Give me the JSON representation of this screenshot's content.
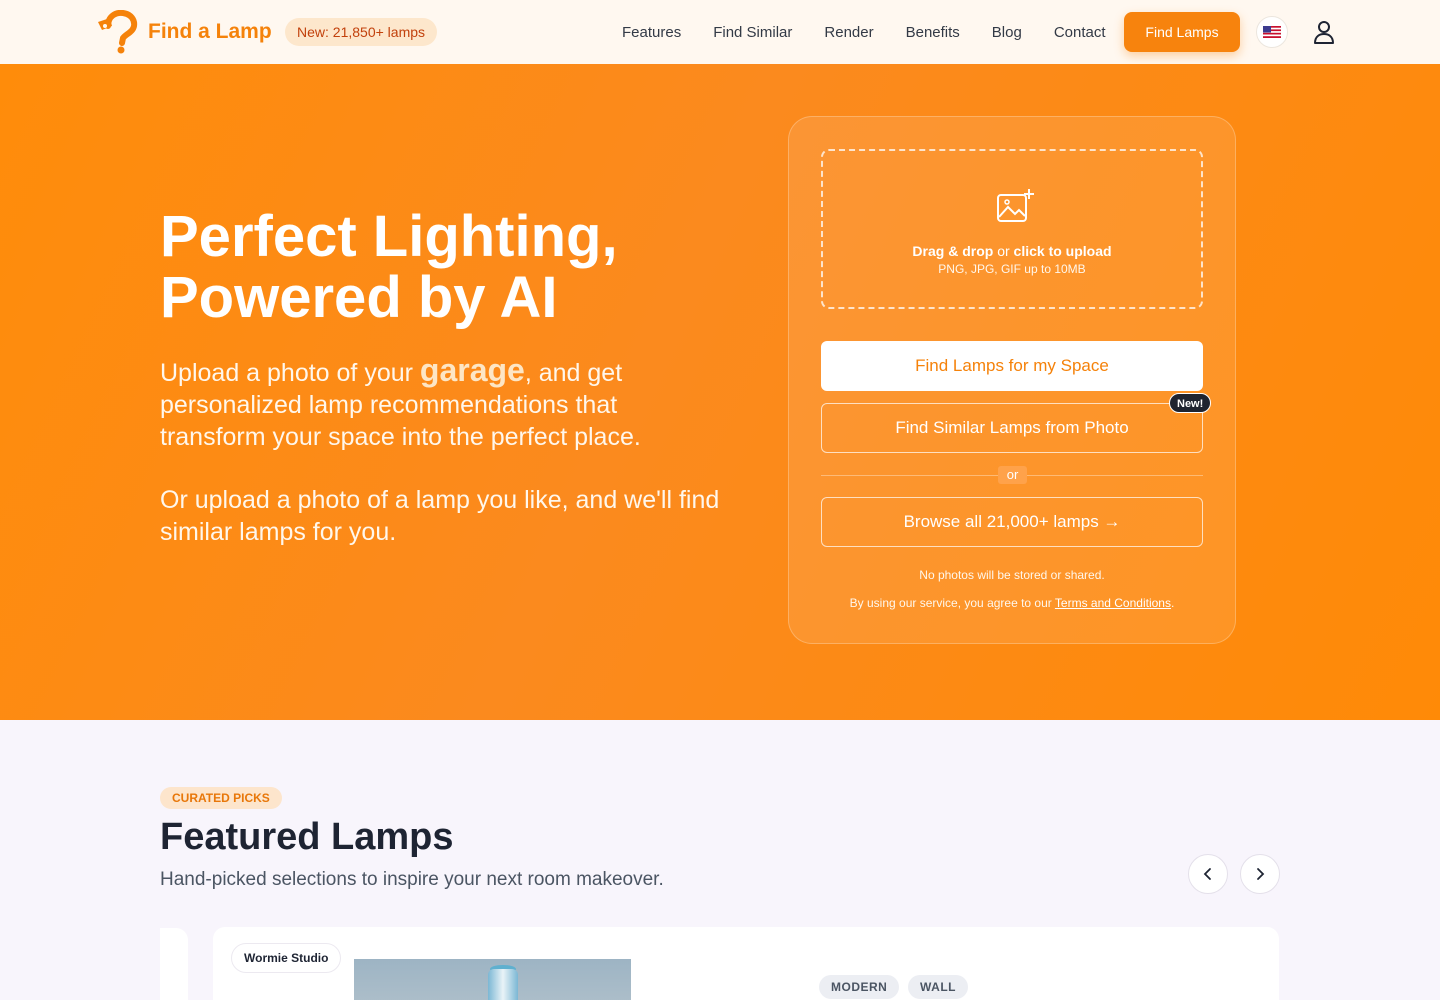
{
  "header": {
    "brand": "Find a Lamp",
    "count_badge": "New: 21,850+ lamps",
    "nav": [
      "Features",
      "Find Similar",
      "Render",
      "Benefits",
      "Blog",
      "Contact"
    ],
    "cta": "Find Lamps",
    "flag_icon": "us-flag-icon",
    "user_icon": "user-icon"
  },
  "hero": {
    "title_line1": "Perfect Lighting,",
    "title_line2": "Powered by AI",
    "sub_prefix": "Upload a photo of your ",
    "sub_highlight": "garage",
    "sub_suffix": ", and get personalized lamp recommendations that transform your space into the perfect place.",
    "sub2": "Or upload a photo of a lamp you like, and we'll find similar lamps for you."
  },
  "upload": {
    "drag_text": "Drag & drop",
    "or_text": " or ",
    "click_text": "click to upload",
    "hint": "PNG, JPG, GIF up to 10MB",
    "btn_find_space": "Find Lamps for my Space",
    "btn_find_similar": "Find Similar Lamps from Photo",
    "new_badge": "New!",
    "or_label": "or",
    "btn_browse": "Browse all 21,000+ lamps →",
    "privacy": "No photos will be stored or shared.",
    "terms_prefix": "By using our service, you agree to our ",
    "terms_link": "Terms and Conditions",
    "terms_suffix": "."
  },
  "featured": {
    "eyebrow": "CURATED PICKS",
    "title": "Featured Lamps",
    "subtitle": "Hand-picked selections to inspire your next room makeover.",
    "card": {
      "studio": "Wormie Studio",
      "tags": [
        "MODERN",
        "WALL"
      ]
    }
  },
  "colors": {
    "brand_orange": "#f7830d",
    "hero_bg": "#ff8c0a",
    "dark": "#1e2433"
  }
}
